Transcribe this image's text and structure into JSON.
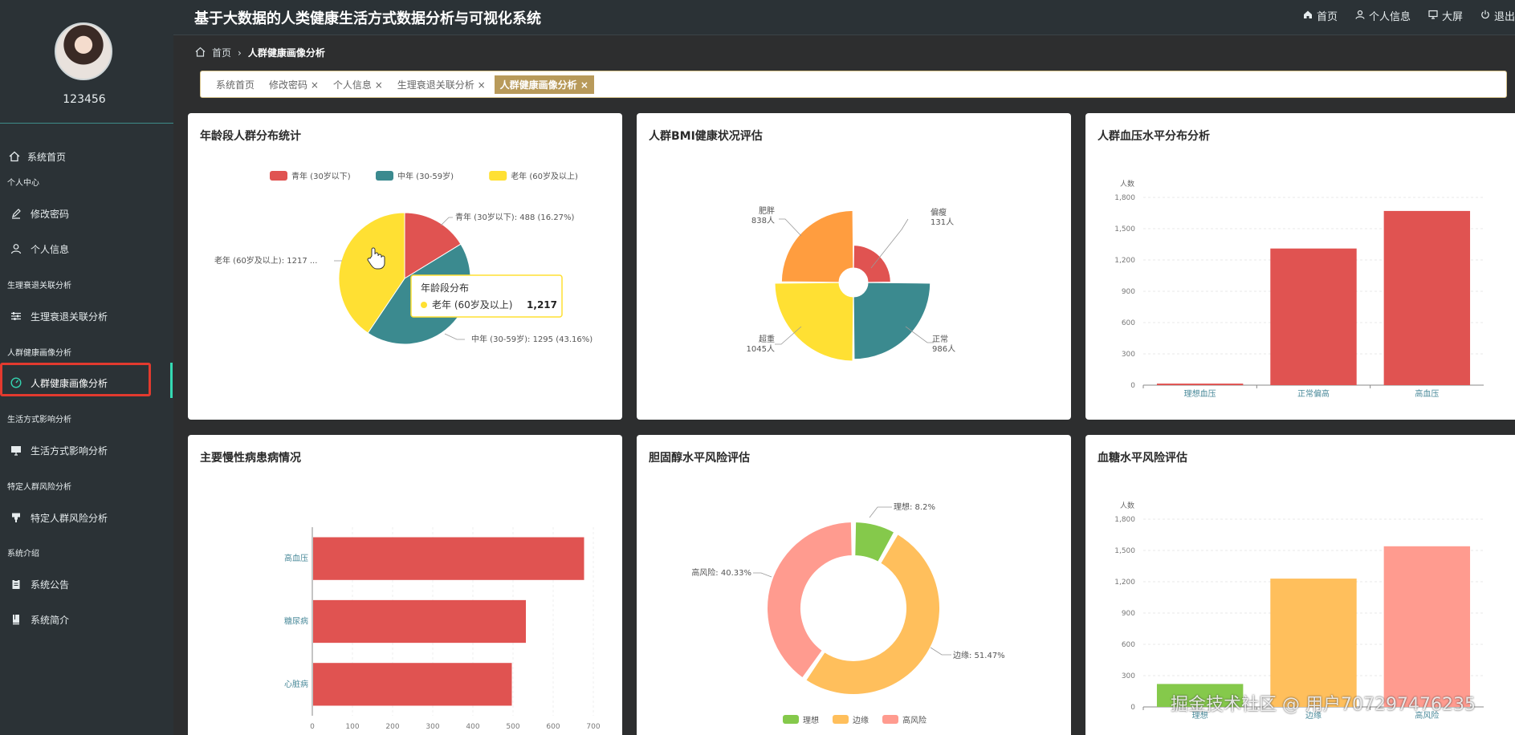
{
  "header": {
    "title": "基于大数据的人类健康生活方式数据分析与可视化系统",
    "nav": [
      {
        "label": "首页",
        "icon": "home-icon"
      },
      {
        "label": "个人信息",
        "icon": "user-icon"
      },
      {
        "label": "大屏",
        "icon": "monitor-icon"
      },
      {
        "label": "退出",
        "icon": "power-icon"
      }
    ]
  },
  "sidebar": {
    "username": "123456",
    "items": [
      {
        "label": "系统首页",
        "icon": "home-icon"
      },
      {
        "label": "个人中心"
      },
      {
        "label": "修改密码",
        "icon": "edit-icon"
      },
      {
        "label": "个人信息",
        "icon": "user-icon"
      },
      {
        "label": "生理衰退关联分析"
      },
      {
        "label": "生理衰退关联分析",
        "icon": "sliders-icon"
      },
      {
        "label": "人群健康画像分析"
      },
      {
        "label": "人群健康画像分析",
        "icon": "gauge-icon"
      },
      {
        "label": "生活方式影响分析"
      },
      {
        "label": "生活方式影响分析",
        "icon": "monitor-icon"
      },
      {
        "label": "特定人群风险分析"
      },
      {
        "label": "特定人群风险分析",
        "icon": "stamp-icon"
      },
      {
        "label": "系统介绍"
      },
      {
        "label": "系统公告",
        "icon": "clipboard-icon"
      },
      {
        "label": "系统简介",
        "icon": "book-icon"
      }
    ]
  },
  "breadcrumb": {
    "home": "首页",
    "current": "人群健康画像分析"
  },
  "tags": [
    {
      "label": "系统首页"
    },
    {
      "label": "修改密码 ×"
    },
    {
      "label": "个人信息 ×"
    },
    {
      "label": "生理衰退关联分析 ×"
    },
    {
      "label": "人群健康画像分析 ×"
    }
  ],
  "watermark": "掘金技术社区 @ 用户707297476235",
  "colors": {
    "red": "#e05351",
    "teal": "#3b8a8f",
    "yellow": "#ffe033",
    "orange": "#ff9d3f",
    "green": "#85c94b",
    "amber": "#ffbf5c",
    "salmon": "#ff9b8f"
  },
  "chart_data": [
    {
      "id": "age",
      "type": "pie",
      "title": "年龄段人群分布统计",
      "series": [
        {
          "name": "青年 (30岁以下)",
          "value": 488,
          "pct": "16.27%",
          "label": "青年 (30岁以下): 488 (16.27%)"
        },
        {
          "name": "中年 (30-59岁)",
          "value": 1295,
          "pct": "43.16%",
          "label": "中年 (30-59岁): 1295 (43.16%)"
        },
        {
          "name": "老年 (60岁及以上)",
          "value": 1217,
          "label": "老年 (60岁及以上): 1217 ..."
        }
      ],
      "legend": [
        "青年 (30岁以下)",
        "中年 (30-59岁)",
        "老年 (60岁及以上)"
      ],
      "tooltip": {
        "title": "年龄段分布",
        "name": "老年 (60岁及以上)",
        "value": "1,217"
      }
    },
    {
      "id": "bmi",
      "type": "pie",
      "title": "人群BMI健康状况评估",
      "series": [
        {
          "name": "偏瘦",
          "value": 131,
          "label": "131人"
        },
        {
          "name": "正常",
          "value": 986,
          "label": "986人"
        },
        {
          "name": "超重",
          "value": 1045,
          "label": "1045人"
        },
        {
          "name": "肥胖",
          "value": 838,
          "label": "838人"
        }
      ]
    },
    {
      "id": "bp",
      "type": "bar",
      "title": "人群血压水平分布分析",
      "ylabel": "人数",
      "categories": [
        "理想血压",
        "正常偏高",
        "高血压"
      ],
      "values": [
        15,
        1310,
        1670
      ],
      "ylim": [
        0,
        1800
      ],
      "ticks": [
        "0",
        "300",
        "600",
        "900",
        "1,200",
        "1,500",
        "1,800"
      ]
    },
    {
      "id": "chronic",
      "type": "bar",
      "title": "主要慢性病患病情况",
      "categories": [
        "高血压",
        "糖尿病",
        "心脏病"
      ],
      "values": [
        675,
        530,
        495
      ],
      "xlim": [
        0,
        700
      ],
      "ticks": [
        "0",
        "100",
        "200",
        "300",
        "400",
        "500",
        "600",
        "700"
      ]
    },
    {
      "id": "chol",
      "type": "pie",
      "title": "胆固醇水平风险评估",
      "series": [
        {
          "name": "理想",
          "pct": 8.2,
          "label": "理想: 8.2%"
        },
        {
          "name": "边缘",
          "pct": 51.47,
          "label": "边缘: 51.47%"
        },
        {
          "name": "高风险",
          "pct": 40.33,
          "label": "高风险: 40.33%"
        }
      ],
      "legend": [
        "理想",
        "边缘",
        "高风险"
      ]
    },
    {
      "id": "sugar",
      "type": "bar",
      "title": "血糖水平风险评估",
      "ylabel": "人数",
      "categories": [
        "理想",
        "边缘",
        "高风险"
      ],
      "values": [
        220,
        1230,
        1540
      ],
      "ylim": [
        0,
        1800
      ],
      "ticks": [
        "0",
        "300",
        "600",
        "900",
        "1,200",
        "1,500",
        "1,800"
      ]
    }
  ]
}
